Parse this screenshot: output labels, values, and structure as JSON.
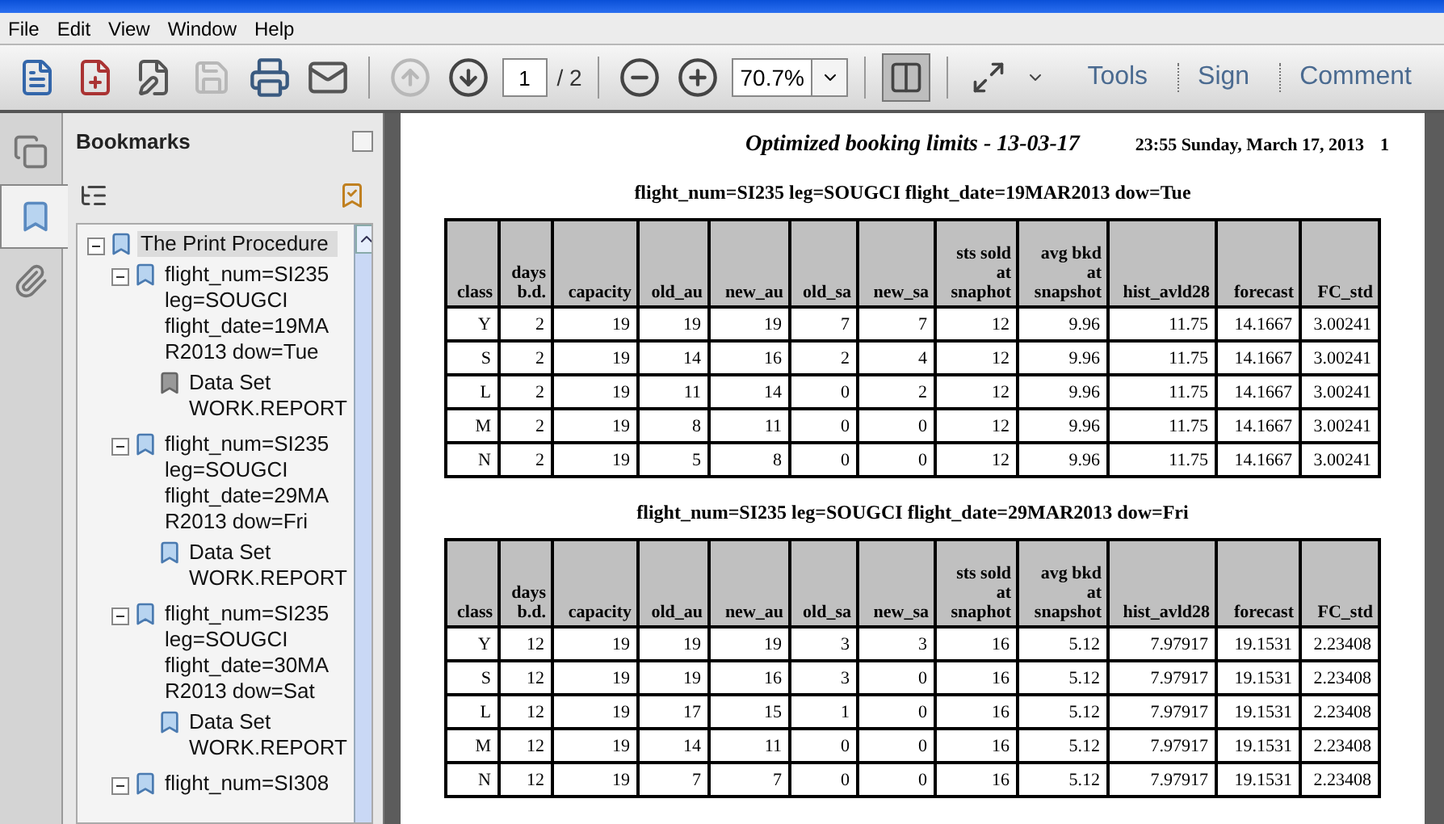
{
  "menu": [
    "File",
    "Edit",
    "View",
    "Window",
    "Help"
  ],
  "toolbar": {
    "save": {
      "disabled": true
    },
    "previous_page": {
      "disabled": true
    },
    "page": "1",
    "page_total": "/ 2",
    "zoom": "70.7%",
    "fit_width": {
      "selected": true
    },
    "links": [
      "Tools",
      "Sign",
      "Comment"
    ]
  },
  "nav_tabs": [
    {
      "kind": "pages",
      "selected": false
    },
    {
      "kind": "bookmarks",
      "selected": true
    },
    {
      "kind": "attachments",
      "selected": false
    }
  ],
  "bookmarks": {
    "title": "Bookmarks",
    "items": [
      {
        "label": "The Print Procedure",
        "selected": true,
        "expanded": true,
        "children": [
          {
            "label": "flight_num=SI235 leg=SOUGCI flight_date=19MAR2013 dow=Tue",
            "selected": false,
            "expanded": true,
            "children": [
              {
                "label": "Data Set WORK.REPORT",
                "selected": false,
                "dimmed": true
              }
            ]
          },
          {
            "label": "flight_num=SI235 leg=SOUGCI flight_date=29MAR2013 dow=Fri",
            "selected": false,
            "expanded": true,
            "children": [
              {
                "label": "Data Set WORK.REPORT",
                "selected": false,
                "dimmed": false
              }
            ]
          },
          {
            "label": "flight_num=SI235 leg=SOUGCI flight_date=30MAR2013 dow=Sat",
            "selected": false,
            "expanded": true,
            "children": [
              {
                "label": "Data Set WORK.REPORT",
                "selected": false,
                "dimmed": false
              }
            ]
          },
          {
            "label": "flight_num=SI308",
            "selected": false,
            "expanded": true
          }
        ]
      }
    ]
  },
  "document": {
    "title": "Optimized booking limits - 13-03-17",
    "datetime": "23:55 Sunday, March 17, 2013",
    "page_number": "1",
    "sections": [
      {
        "heading": "flight_num=SI235 leg=SOUGCI flight_date=19MAR2013 dow=Tue",
        "columns": [
          "class",
          "days b.d.",
          "capacity",
          "old_au",
          "new_au",
          "old_sa",
          "new_sa",
          "sts sold at snaphot",
          "avg bkd at snapshot",
          "hist_avld28",
          "forecast",
          "FC_std"
        ],
        "rows": [
          [
            "Y",
            "2",
            "19",
            "19",
            "19",
            "7",
            "7",
            "12",
            "9.96",
            "11.75",
            "14.1667",
            "3.00241"
          ],
          [
            "S",
            "2",
            "19",
            "14",
            "16",
            "2",
            "4",
            "12",
            "9.96",
            "11.75",
            "14.1667",
            "3.00241"
          ],
          [
            "L",
            "2",
            "19",
            "11",
            "14",
            "0",
            "2",
            "12",
            "9.96",
            "11.75",
            "14.1667",
            "3.00241"
          ],
          [
            "M",
            "2",
            "19",
            "8",
            "11",
            "0",
            "0",
            "12",
            "9.96",
            "11.75",
            "14.1667",
            "3.00241"
          ],
          [
            "N",
            "2",
            "19",
            "5",
            "8",
            "0",
            "0",
            "12",
            "9.96",
            "11.75",
            "14.1667",
            "3.00241"
          ]
        ]
      },
      {
        "heading": "flight_num=SI235 leg=SOUGCI flight_date=29MAR2013 dow=Fri",
        "columns": [
          "class",
          "days b.d.",
          "capacity",
          "old_au",
          "new_au",
          "old_sa",
          "new_sa",
          "sts sold at snaphot",
          "avg bkd at snapshot",
          "hist_avld28",
          "forecast",
          "FC_std"
        ],
        "rows": [
          [
            "Y",
            "12",
            "19",
            "19",
            "19",
            "3",
            "3",
            "16",
            "5.12",
            "7.97917",
            "19.1531",
            "2.23408"
          ],
          [
            "S",
            "12",
            "19",
            "19",
            "16",
            "3",
            "0",
            "16",
            "5.12",
            "7.97917",
            "19.1531",
            "2.23408"
          ],
          [
            "L",
            "12",
            "19",
            "17",
            "15",
            "1",
            "0",
            "16",
            "5.12",
            "7.97917",
            "19.1531",
            "2.23408"
          ],
          [
            "M",
            "12",
            "19",
            "14",
            "11",
            "0",
            "0",
            "16",
            "5.12",
            "7.97917",
            "19.1531",
            "2.23408"
          ],
          [
            "N",
            "12",
            "19",
            "7",
            "7",
            "0",
            "0",
            "16",
            "5.12",
            "7.97917",
            "19.1531",
            "2.23408"
          ]
        ]
      }
    ]
  }
}
